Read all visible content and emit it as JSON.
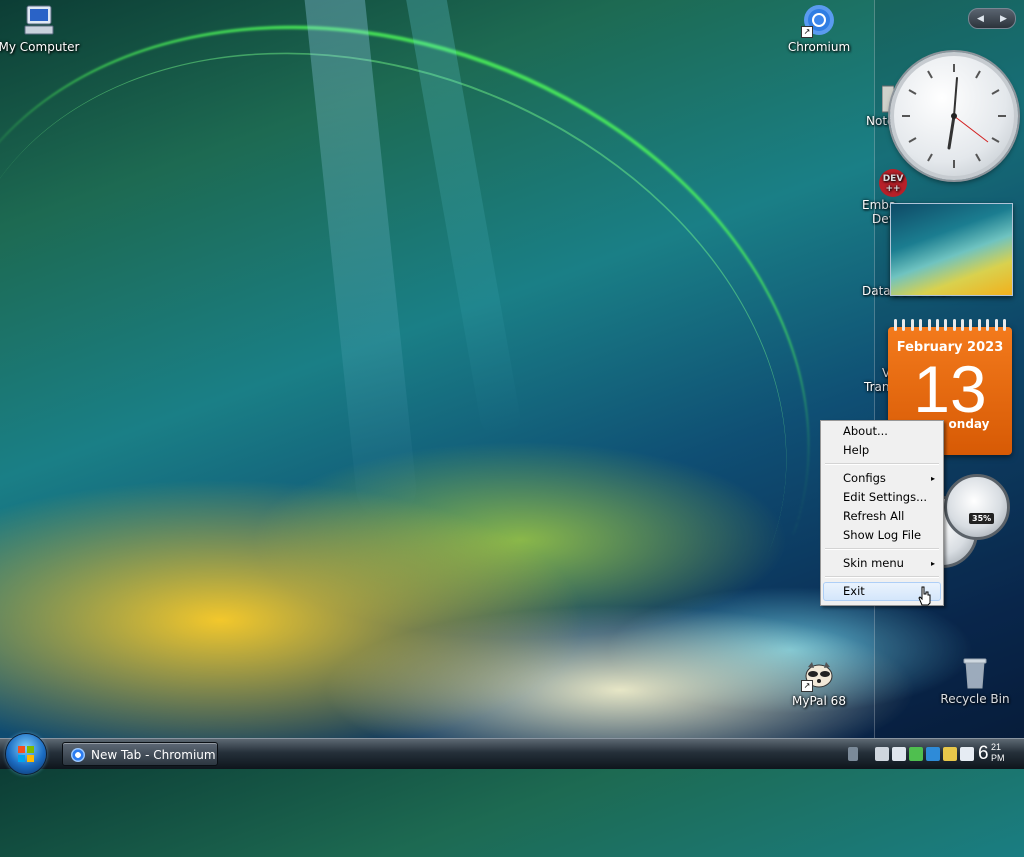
{
  "desktop": {
    "icons": {
      "my_computer": "My Computer",
      "chromium": "Chromium",
      "notepad_partial": "Note",
      "embarcadero_line1": "Emba",
      "embarcadero_line2": "Dev",
      "dev_badge_line1": "DEV",
      "dev_badge_line2": "++",
      "datagenerator_partial": "DataGenerator",
      "trans_partial": "Tran",
      "v_partial": "V",
      "mypal": "MyPal 68",
      "recycle_bin": "Recycle Bin"
    }
  },
  "sidebar": {
    "nav_prev": "◀",
    "nav_next": "▶",
    "calendar": {
      "month_year": "February 2023",
      "day": "13",
      "weekday_partial": "onday"
    },
    "cpu_meter": {
      "value_label": "35%",
      "value": 35
    }
  },
  "context_menu": {
    "items": {
      "about": "About...",
      "help": "Help",
      "configs": "Configs",
      "edit_settings": "Edit Settings...",
      "refresh_all": "Refresh All",
      "show_log_file": "Show Log File",
      "skin_menu": "Skin menu",
      "exit": "Exit"
    },
    "submenu_arrow": "▸"
  },
  "taskbar": {
    "task_button_label": "New Tab - Chromium",
    "clock": {
      "hour": "6",
      "minute": "21",
      "ampm": "PM"
    }
  },
  "colors": {
    "calendar_orange": "#e8670f",
    "menu_bg": "#f0f0f0",
    "menu_hover": "#d4e6fb"
  }
}
